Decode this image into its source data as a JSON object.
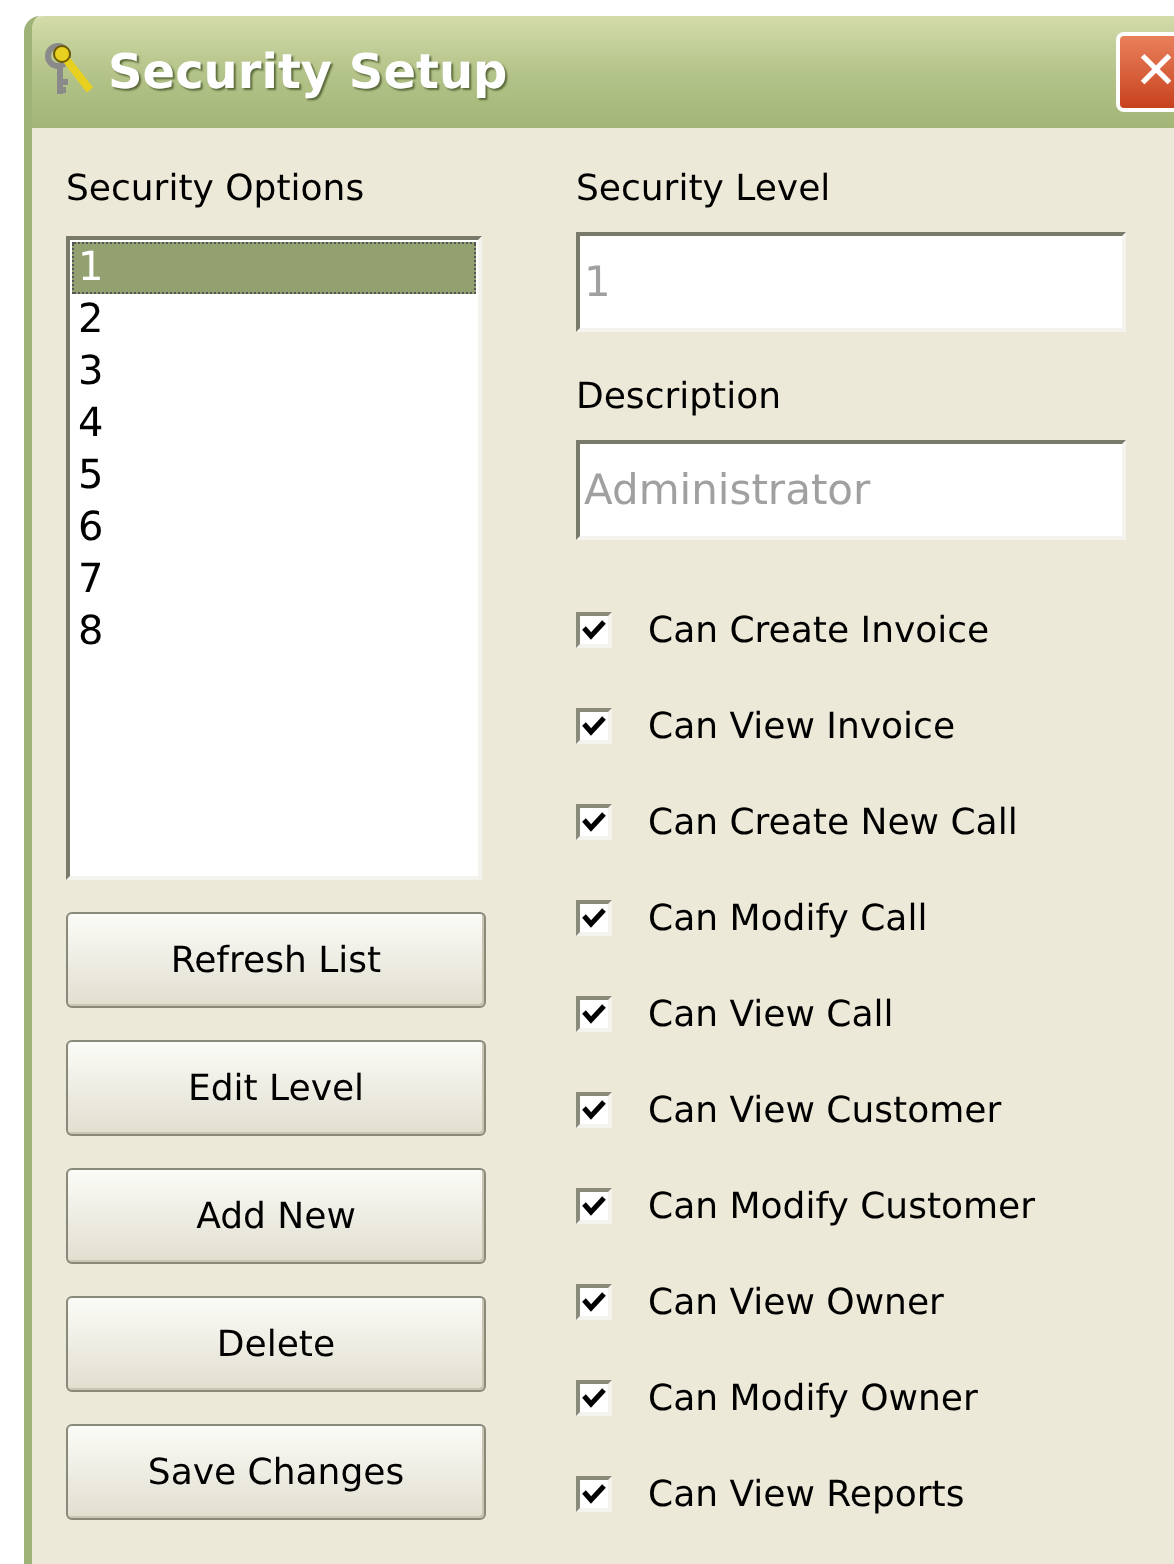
{
  "window": {
    "title": "Security Setup",
    "close": "✕"
  },
  "options": {
    "label": "Security Options",
    "items": [
      {
        "label": "1",
        "selected": true
      },
      {
        "label": "2",
        "selected": false
      },
      {
        "label": "3",
        "selected": false
      },
      {
        "label": "4",
        "selected": false
      },
      {
        "label": "5",
        "selected": false
      },
      {
        "label": "6",
        "selected": false
      },
      {
        "label": "7",
        "selected": false
      },
      {
        "label": "8",
        "selected": false
      }
    ]
  },
  "buttons": [
    "Refresh List",
    "Edit Level",
    "Add New",
    "Delete",
    "Save Changes"
  ],
  "fields": [
    {
      "label": "Security Level",
      "value": "1",
      "disabled": true
    },
    {
      "label": "Description",
      "value": "Administrator",
      "disabled": true
    }
  ],
  "permissions": [
    {
      "label": "Can Create Invoice",
      "checked": true
    },
    {
      "label": "Can View Invoice",
      "checked": true
    },
    {
      "label": "Can Create New Call",
      "checked": true
    },
    {
      "label": "Can Modify Call",
      "checked": true
    },
    {
      "label": "Can View Call",
      "checked": true
    },
    {
      "label": "Can View Customer",
      "checked": true
    },
    {
      "label": "Can Modify Customer",
      "checked": true
    },
    {
      "label": "Can View Owner",
      "checked": true
    },
    {
      "label": "Can Modify Owner",
      "checked": true
    },
    {
      "label": "Can View Reports",
      "checked": true
    }
  ]
}
